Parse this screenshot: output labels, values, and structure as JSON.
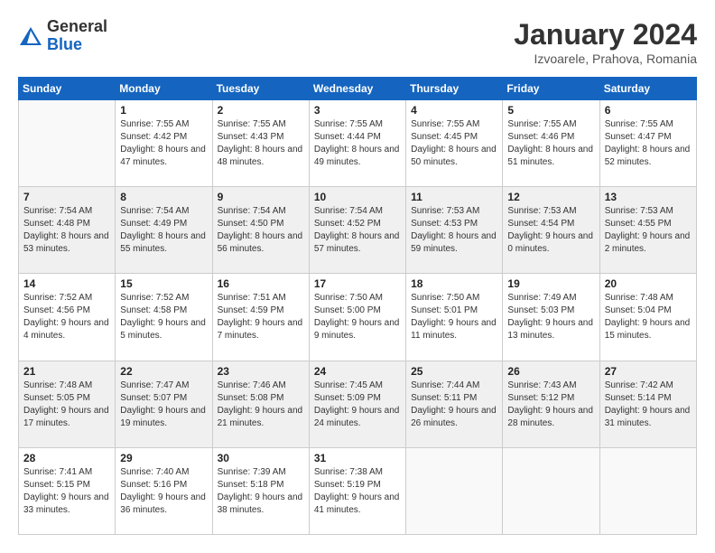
{
  "header": {
    "logo_general": "General",
    "logo_blue": "Blue",
    "month_title": "January 2024",
    "location": "Izvoarele, Prahova, Romania"
  },
  "weekdays": [
    "Sunday",
    "Monday",
    "Tuesday",
    "Wednesday",
    "Thursday",
    "Friday",
    "Saturday"
  ],
  "weeks": [
    [
      {
        "day": "",
        "info": ""
      },
      {
        "day": "1",
        "info": "Sunrise: 7:55 AM\nSunset: 4:42 PM\nDaylight: 8 hours\nand 47 minutes."
      },
      {
        "day": "2",
        "info": "Sunrise: 7:55 AM\nSunset: 4:43 PM\nDaylight: 8 hours\nand 48 minutes."
      },
      {
        "day": "3",
        "info": "Sunrise: 7:55 AM\nSunset: 4:44 PM\nDaylight: 8 hours\nand 49 minutes."
      },
      {
        "day": "4",
        "info": "Sunrise: 7:55 AM\nSunset: 4:45 PM\nDaylight: 8 hours\nand 50 minutes."
      },
      {
        "day": "5",
        "info": "Sunrise: 7:55 AM\nSunset: 4:46 PM\nDaylight: 8 hours\nand 51 minutes."
      },
      {
        "day": "6",
        "info": "Sunrise: 7:55 AM\nSunset: 4:47 PM\nDaylight: 8 hours\nand 52 minutes."
      }
    ],
    [
      {
        "day": "7",
        "info": "Sunrise: 7:54 AM\nSunset: 4:48 PM\nDaylight: 8 hours\nand 53 minutes."
      },
      {
        "day": "8",
        "info": "Sunrise: 7:54 AM\nSunset: 4:49 PM\nDaylight: 8 hours\nand 55 minutes."
      },
      {
        "day": "9",
        "info": "Sunrise: 7:54 AM\nSunset: 4:50 PM\nDaylight: 8 hours\nand 56 minutes."
      },
      {
        "day": "10",
        "info": "Sunrise: 7:54 AM\nSunset: 4:52 PM\nDaylight: 8 hours\nand 57 minutes."
      },
      {
        "day": "11",
        "info": "Sunrise: 7:53 AM\nSunset: 4:53 PM\nDaylight: 8 hours\nand 59 minutes."
      },
      {
        "day": "12",
        "info": "Sunrise: 7:53 AM\nSunset: 4:54 PM\nDaylight: 9 hours\nand 0 minutes."
      },
      {
        "day": "13",
        "info": "Sunrise: 7:53 AM\nSunset: 4:55 PM\nDaylight: 9 hours\nand 2 minutes."
      }
    ],
    [
      {
        "day": "14",
        "info": "Sunrise: 7:52 AM\nSunset: 4:56 PM\nDaylight: 9 hours\nand 4 minutes."
      },
      {
        "day": "15",
        "info": "Sunrise: 7:52 AM\nSunset: 4:58 PM\nDaylight: 9 hours\nand 5 minutes."
      },
      {
        "day": "16",
        "info": "Sunrise: 7:51 AM\nSunset: 4:59 PM\nDaylight: 9 hours\nand 7 minutes."
      },
      {
        "day": "17",
        "info": "Sunrise: 7:50 AM\nSunset: 5:00 PM\nDaylight: 9 hours\nand 9 minutes."
      },
      {
        "day": "18",
        "info": "Sunrise: 7:50 AM\nSunset: 5:01 PM\nDaylight: 9 hours\nand 11 minutes."
      },
      {
        "day": "19",
        "info": "Sunrise: 7:49 AM\nSunset: 5:03 PM\nDaylight: 9 hours\nand 13 minutes."
      },
      {
        "day": "20",
        "info": "Sunrise: 7:48 AM\nSunset: 5:04 PM\nDaylight: 9 hours\nand 15 minutes."
      }
    ],
    [
      {
        "day": "21",
        "info": "Sunrise: 7:48 AM\nSunset: 5:05 PM\nDaylight: 9 hours\nand 17 minutes."
      },
      {
        "day": "22",
        "info": "Sunrise: 7:47 AM\nSunset: 5:07 PM\nDaylight: 9 hours\nand 19 minutes."
      },
      {
        "day": "23",
        "info": "Sunrise: 7:46 AM\nSunset: 5:08 PM\nDaylight: 9 hours\nand 21 minutes."
      },
      {
        "day": "24",
        "info": "Sunrise: 7:45 AM\nSunset: 5:09 PM\nDaylight: 9 hours\nand 24 minutes."
      },
      {
        "day": "25",
        "info": "Sunrise: 7:44 AM\nSunset: 5:11 PM\nDaylight: 9 hours\nand 26 minutes."
      },
      {
        "day": "26",
        "info": "Sunrise: 7:43 AM\nSunset: 5:12 PM\nDaylight: 9 hours\nand 28 minutes."
      },
      {
        "day": "27",
        "info": "Sunrise: 7:42 AM\nSunset: 5:14 PM\nDaylight: 9 hours\nand 31 minutes."
      }
    ],
    [
      {
        "day": "28",
        "info": "Sunrise: 7:41 AM\nSunset: 5:15 PM\nDaylight: 9 hours\nand 33 minutes."
      },
      {
        "day": "29",
        "info": "Sunrise: 7:40 AM\nSunset: 5:16 PM\nDaylight: 9 hours\nand 36 minutes."
      },
      {
        "day": "30",
        "info": "Sunrise: 7:39 AM\nSunset: 5:18 PM\nDaylight: 9 hours\nand 38 minutes."
      },
      {
        "day": "31",
        "info": "Sunrise: 7:38 AM\nSunset: 5:19 PM\nDaylight: 9 hours\nand 41 minutes."
      },
      {
        "day": "",
        "info": ""
      },
      {
        "day": "",
        "info": ""
      },
      {
        "day": "",
        "info": ""
      }
    ]
  ]
}
